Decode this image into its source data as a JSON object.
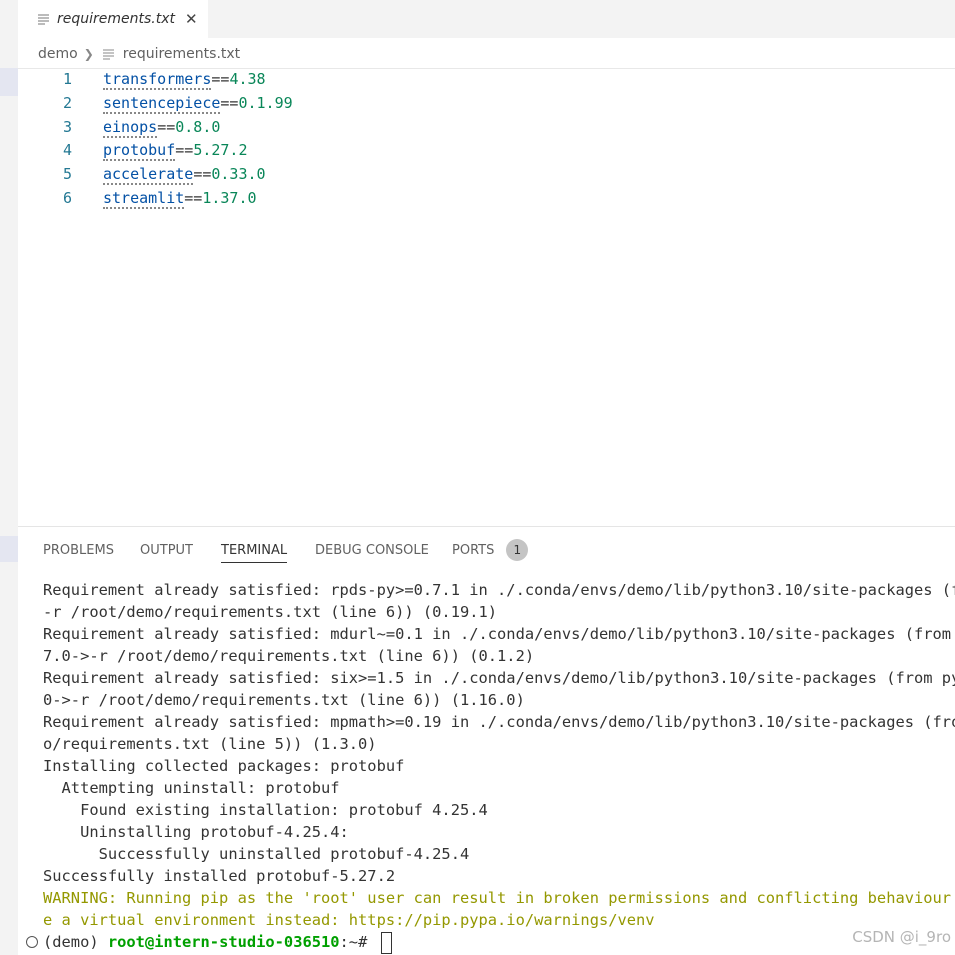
{
  "tab": {
    "label": "requirements.txt",
    "close_symbol": "✕"
  },
  "breadcrumb": {
    "folder": "demo",
    "file": "requirements.txt"
  },
  "editor_lines": [
    {
      "num": "1",
      "pkg": "transformers",
      "op": "==",
      "ver": "4.38"
    },
    {
      "num": "2",
      "pkg": "sentencepiece",
      "op": "==",
      "ver": "0.1.99"
    },
    {
      "num": "3",
      "pkg": "einops",
      "op": "==",
      "ver": "0.8.0"
    },
    {
      "num": "4",
      "pkg": "protobuf",
      "op": "==",
      "ver": "5.27.2"
    },
    {
      "num": "5",
      "pkg": "accelerate",
      "op": "==",
      "ver": "0.33.0"
    },
    {
      "num": "6",
      "pkg": "streamlit",
      "op": "==",
      "ver": "1.37.0"
    }
  ],
  "panel_tabs": {
    "problems": "PROBLEMS",
    "output": "OUTPUT",
    "terminal": "TERMINAL",
    "debug_console": "DEBUG CONSOLE",
    "ports": "PORTS",
    "ports_badge": "1"
  },
  "terminal": {
    "lines": [
      "Requirement already satisfied: rpds-py>=0.7.1 in ./.conda/envs/demo/lib/python3.10/site-packages (from",
      "-r /root/demo/requirements.txt (line 6)) (0.19.1)",
      "Requirement already satisfied: mdurl~=0.1 in ./.conda/envs/demo/lib/python3.10/site-packages (from mar",
      "7.0->-r /root/demo/requirements.txt (line 6)) (0.1.2)",
      "Requirement already satisfied: six>=1.5 in ./.conda/envs/demo/lib/python3.10/site-packages (from pytho",
      "0->-r /root/demo/requirements.txt (line 6)) (1.16.0)",
      "Requirement already satisfied: mpmath>=0.19 in ./.conda/envs/demo/lib/python3.10/site-packages (from s",
      "o/requirements.txt (line 5)) (1.3.0)",
      "Installing collected packages: protobuf",
      "  Attempting uninstall: protobuf",
      "    Found existing installation: protobuf 4.25.4",
      "    Uninstalling protobuf-4.25.4:",
      "      Successfully uninstalled protobuf-4.25.4",
      "Successfully installed protobuf-5.27.2"
    ],
    "warnings": [
      "WARNING: Running pip as the 'root' user can result in broken permissions and conflicting behaviour wit",
      "e a virtual environment instead: https://pip.pypa.io/warnings/venv"
    ],
    "prompt": {
      "env": "(demo) ",
      "user": "root@intern-studio-036510",
      "path": ":~# "
    }
  },
  "watermark": "CSDN @i_9ro",
  "colors": {
    "package": "#0451a5",
    "version": "#098658",
    "line_number": "#237893",
    "warning": "#949800",
    "prompt_user": "#00a000"
  }
}
